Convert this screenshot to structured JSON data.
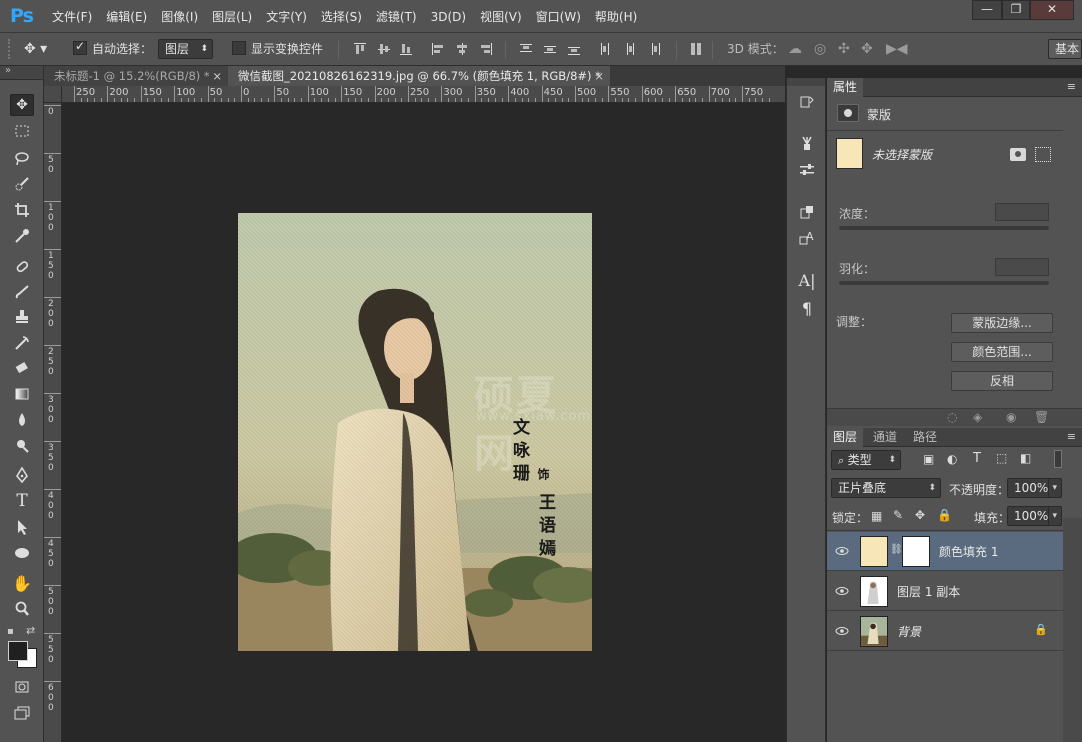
{
  "app": {
    "logo": "Ps"
  },
  "menus": [
    "文件(F)",
    "编辑(E)",
    "图像(I)",
    "图层(L)",
    "文字(Y)",
    "选择(S)",
    "滤镜(T)",
    "3D(D)",
    "视图(V)",
    "窗口(W)",
    "帮助(H)"
  ],
  "window_controls": {
    "minimize": "—",
    "restore": "❐",
    "close": "✕"
  },
  "options": {
    "auto_select_label": "自动选择：",
    "auto_select_checked": true,
    "auto_select_target": "图层",
    "show_transform_label": "显示变换控件",
    "mode_3d_label": "3D 模式：",
    "workspace": "基本"
  },
  "tabs": [
    {
      "title": "未标题-1 @ 15.2%(RGB/8) *",
      "close": "×",
      "active": false
    },
    {
      "title": "微信截图_20210826162319.jpg @ 66.7% (颜色填充 1, RGB/8#) *",
      "close": "×",
      "active": true
    }
  ],
  "ruler": {
    "h_labels": [
      "250",
      "200",
      "150",
      "100",
      "50",
      "0",
      "50",
      "100",
      "150",
      "200",
      "250",
      "300",
      "350",
      "400",
      "450",
      "500",
      "550",
      "600",
      "650",
      "700",
      "750"
    ],
    "v_labels": [
      "0",
      "50",
      "100",
      "150",
      "200",
      "250",
      "300",
      "350",
      "400",
      "450",
      "500",
      "550",
      "600"
    ]
  },
  "canvas": {
    "watermark": "硕夏网",
    "watermark_url": "www.sxiaw.com",
    "poem_1": "文咏珊",
    "poem_2": "饰",
    "poem_3": "王语嫣"
  },
  "properties": {
    "tab": "属性",
    "section": "蒙版",
    "mask_state": "未选择蒙版",
    "density_label": "浓度：",
    "feather_label": "羽化：",
    "adjust_label": "调整：",
    "btn_mask_edge": "蒙版边缘...",
    "btn_color_range": "颜色范围...",
    "btn_invert": "反相"
  },
  "layers": {
    "tabs": [
      "图层",
      "通道",
      "路径"
    ],
    "filter_kind": "类型",
    "blend_mode": "正片叠底",
    "opacity_label": "不透明度：",
    "opacity": "100%",
    "lock_label": "锁定：",
    "fill_label": "填充：",
    "fill": "100%",
    "items": [
      {
        "name": "颜色填充 1",
        "selected": true
      },
      {
        "name": "图层 1 副本",
        "selected": false
      },
      {
        "name": "背景",
        "selected": false,
        "locked": true
      }
    ]
  },
  "colors": {
    "accent": "#31a8ff",
    "fill_color": "#f7e6b8",
    "selected_layer": "#5b6b7f"
  }
}
